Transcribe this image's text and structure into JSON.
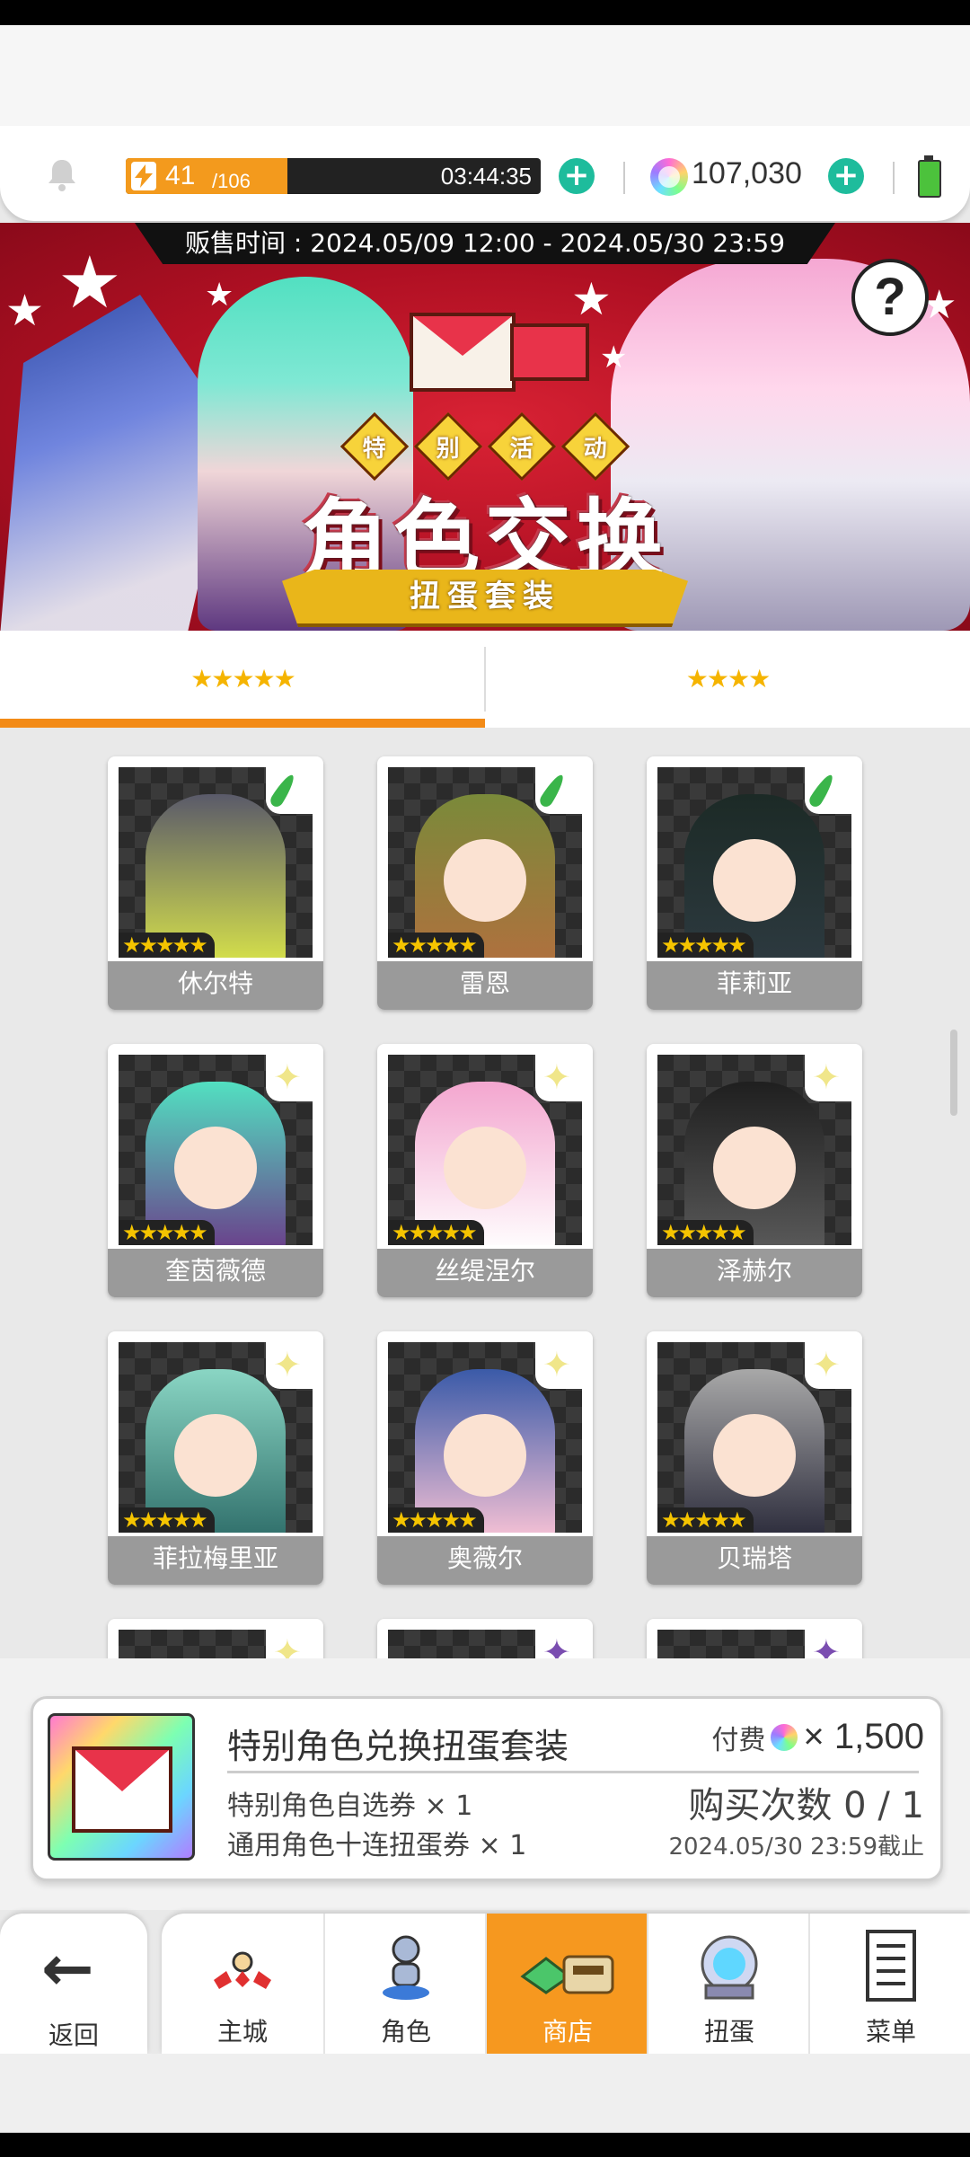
{
  "header": {
    "stamina_current": "41",
    "stamina_max": "/106",
    "stamina_fraction": 0.39,
    "stamina_timer": "03:44:35",
    "gem_count": "107,030",
    "plus_symbol": "+",
    "icons": [
      "bell-icon",
      "lightning-icon",
      "plus-icon",
      "gem-icon",
      "battery-icon"
    ]
  },
  "banner": {
    "sale_time": "贩售时间 : 2024.05/09 12:00 - 2024.05/30 23:59",
    "event_tags": [
      "特",
      "别",
      "活",
      "动"
    ],
    "title": "角色交换",
    "subtitle": "扭蛋套装",
    "help": "?"
  },
  "tabs": [
    {
      "stars": "★★★★★",
      "rarity": 5,
      "active": true
    },
    {
      "stars": "★★★★",
      "rarity": 4,
      "active": false
    }
  ],
  "characters": [
    {
      "name": "休尔特",
      "stars": "★★★★★",
      "badge": "leaf",
      "colors": [
        "#5a5a6a",
        "#d7e24a"
      ]
    },
    {
      "name": "雷恩",
      "stars": "★★★★★",
      "badge": "leaf",
      "colors": [
        "#7a8a3a",
        "#b0703e"
      ]
    },
    {
      "name": "菲莉亚",
      "stars": "★★★★★",
      "badge": "leaf",
      "colors": [
        "#1c2a26",
        "#2d3a40"
      ]
    },
    {
      "name": "奎茵薇德",
      "stars": "★★★★★",
      "badge": "spark",
      "colors": [
        "#52e0c1",
        "#6b3d8a"
      ]
    },
    {
      "name": "丝缇涅尔",
      "stars": "★★★★★",
      "badge": "spark",
      "colors": [
        "#f3a6cf",
        "#ffffff"
      ]
    },
    {
      "name": "泽赫尔",
      "stars": "★★★★★",
      "badge": "spark",
      "colors": [
        "#1f1f1f",
        "#5a5a5a"
      ]
    },
    {
      "name": "菲拉梅里亚",
      "stars": "★★★★★",
      "badge": "spark",
      "colors": [
        "#8ad6c4",
        "#2f6e6a"
      ]
    },
    {
      "name": "奥薇尔",
      "stars": "★★★★★",
      "badge": "spark",
      "colors": [
        "#3a5aa8",
        "#f7c2d5"
      ]
    },
    {
      "name": "贝瑞塔",
      "stars": "★★★★★",
      "badge": "spark",
      "colors": [
        "#a8a8a8",
        "#2a2a3a"
      ]
    }
  ],
  "partial_row_badges": [
    "spark",
    "spark-purple",
    "spark-purple"
  ],
  "purchase": {
    "title": "特别角色兑换扭蛋套装",
    "item1": "特别角色自选券 × 1",
    "item2": "通用角色十连扭蛋券 × 1",
    "price_label": "付费",
    "price_value": "× 1,500",
    "buy_count": "购买次数 0 / 1",
    "deadline": "2024.05/30 23:59截止"
  },
  "nav": {
    "back": "返回",
    "items": [
      {
        "label": "主城",
        "icon": "castle-icon"
      },
      {
        "label": "角色",
        "icon": "character-icon"
      },
      {
        "label": "商店",
        "icon": "shop-icon"
      },
      {
        "label": "扭蛋",
        "icon": "gacha-icon"
      },
      {
        "label": "菜单",
        "icon": "menu-icon"
      }
    ]
  },
  "colors": {
    "accent_orange": "#f6981f",
    "plus_teal": "#1ebc9c",
    "banner_red": "#c0152a",
    "star_gold": "#f5c400"
  }
}
